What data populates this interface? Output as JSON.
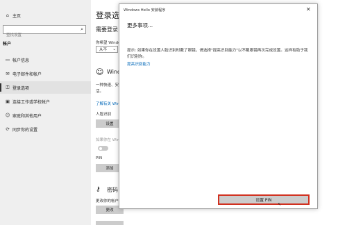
{
  "sidebar": {
    "home_label": "主页",
    "search_placeholder": "查找设置",
    "section_title": "帐户",
    "items": [
      {
        "label": "帐户信息",
        "icon": "person-card-icon"
      },
      {
        "label": "电子邮件和帐户",
        "icon": "mail-icon"
      },
      {
        "label": "登录选项",
        "icon": "key-icon"
      },
      {
        "label": "连接工作或学校帐户",
        "icon": "briefcase-icon"
      },
      {
        "label": "家庭和其他用户",
        "icon": "people-icon"
      },
      {
        "label": "同步你的设置",
        "icon": "sync-icon"
      }
    ]
  },
  "main": {
    "title": "登录选",
    "require_heading": "需要登录",
    "require_text": "你希望 Windo",
    "require_select_value": "从不",
    "hello_heading": "Windo",
    "hello_desc_1": "一种快速、安",
    "hello_desc_2": "活。",
    "learn_more": "了解有关 Windo",
    "face_label": "人脸识别",
    "face_button": "设置",
    "unlock_text": "如果你在 Windo",
    "pin_label": "PIN",
    "pin_button": "添加",
    "password_heading": "密码",
    "password_desc": "更改你的帐户",
    "password_button": "更改"
  },
  "dialog": {
    "title": "Windows Hello 安装程序",
    "heading": "更多事项...",
    "body": "提示: 如果你在设置人脸识别时戴了眼镜，请选择\"提高识别能力\"以不戴眼镜再次完成设置。这样有助于我们识别你。",
    "improve_link": "提高识别能力",
    "primary_button": "设置 PIN",
    "close_glyph": "✕"
  },
  "colors": {
    "accent": "#0067b8",
    "highlight": "#d1301f",
    "sidebar_bg": "#efefef",
    "button_bg": "#cccccc"
  }
}
